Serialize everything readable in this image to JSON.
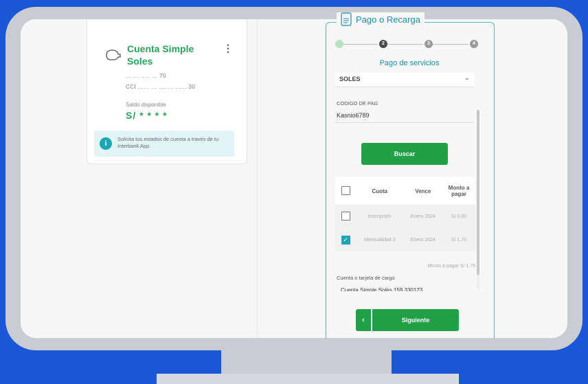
{
  "account": {
    "title": "Cuenta Simple Soles",
    "number_masked": "... ... ..... ... 70",
    "cci_masked": "CCI ...... ... ........ ...... 30",
    "balance_label": "Saldo disponible",
    "balance_value": "S/ * * * *",
    "info_text": "Solicita tus estados de cuenta a través de tu Interbank App."
  },
  "payment": {
    "title": "Pago o Recarga",
    "steps": [
      "",
      "2",
      "3",
      "4"
    ],
    "subtitle": "Pago de servicios",
    "currency": "SOLES",
    "code_label": "CODIGO DE PAG",
    "code_value": "Kasnio6789",
    "search_button": "Buscar",
    "table_headers": [
      "Cuota",
      "Vence",
      "Monto a pagar"
    ],
    "rows": [
      {
        "cuota": "Inscripción",
        "vence": "Enero 2024",
        "monto": "S/ 0.00",
        "checked": false
      },
      {
        "cuota": "Mensualidad 3",
        "vence": "Enero 2024",
        "monto": "S/ 1.75",
        "checked": true
      }
    ],
    "total_text": "Monto a pagar S/ 1.75",
    "charge_label": "Cuenta o tarjeta de cargo",
    "charge_value": "Cuenta Simple Soles 159 330123",
    "back_symbol": "‹",
    "next_button": "Siguiente"
  },
  "colors": {
    "brand_green": "#21a047",
    "accent_teal": "#1a8ea6",
    "background_blue": "#1a56d6"
  }
}
